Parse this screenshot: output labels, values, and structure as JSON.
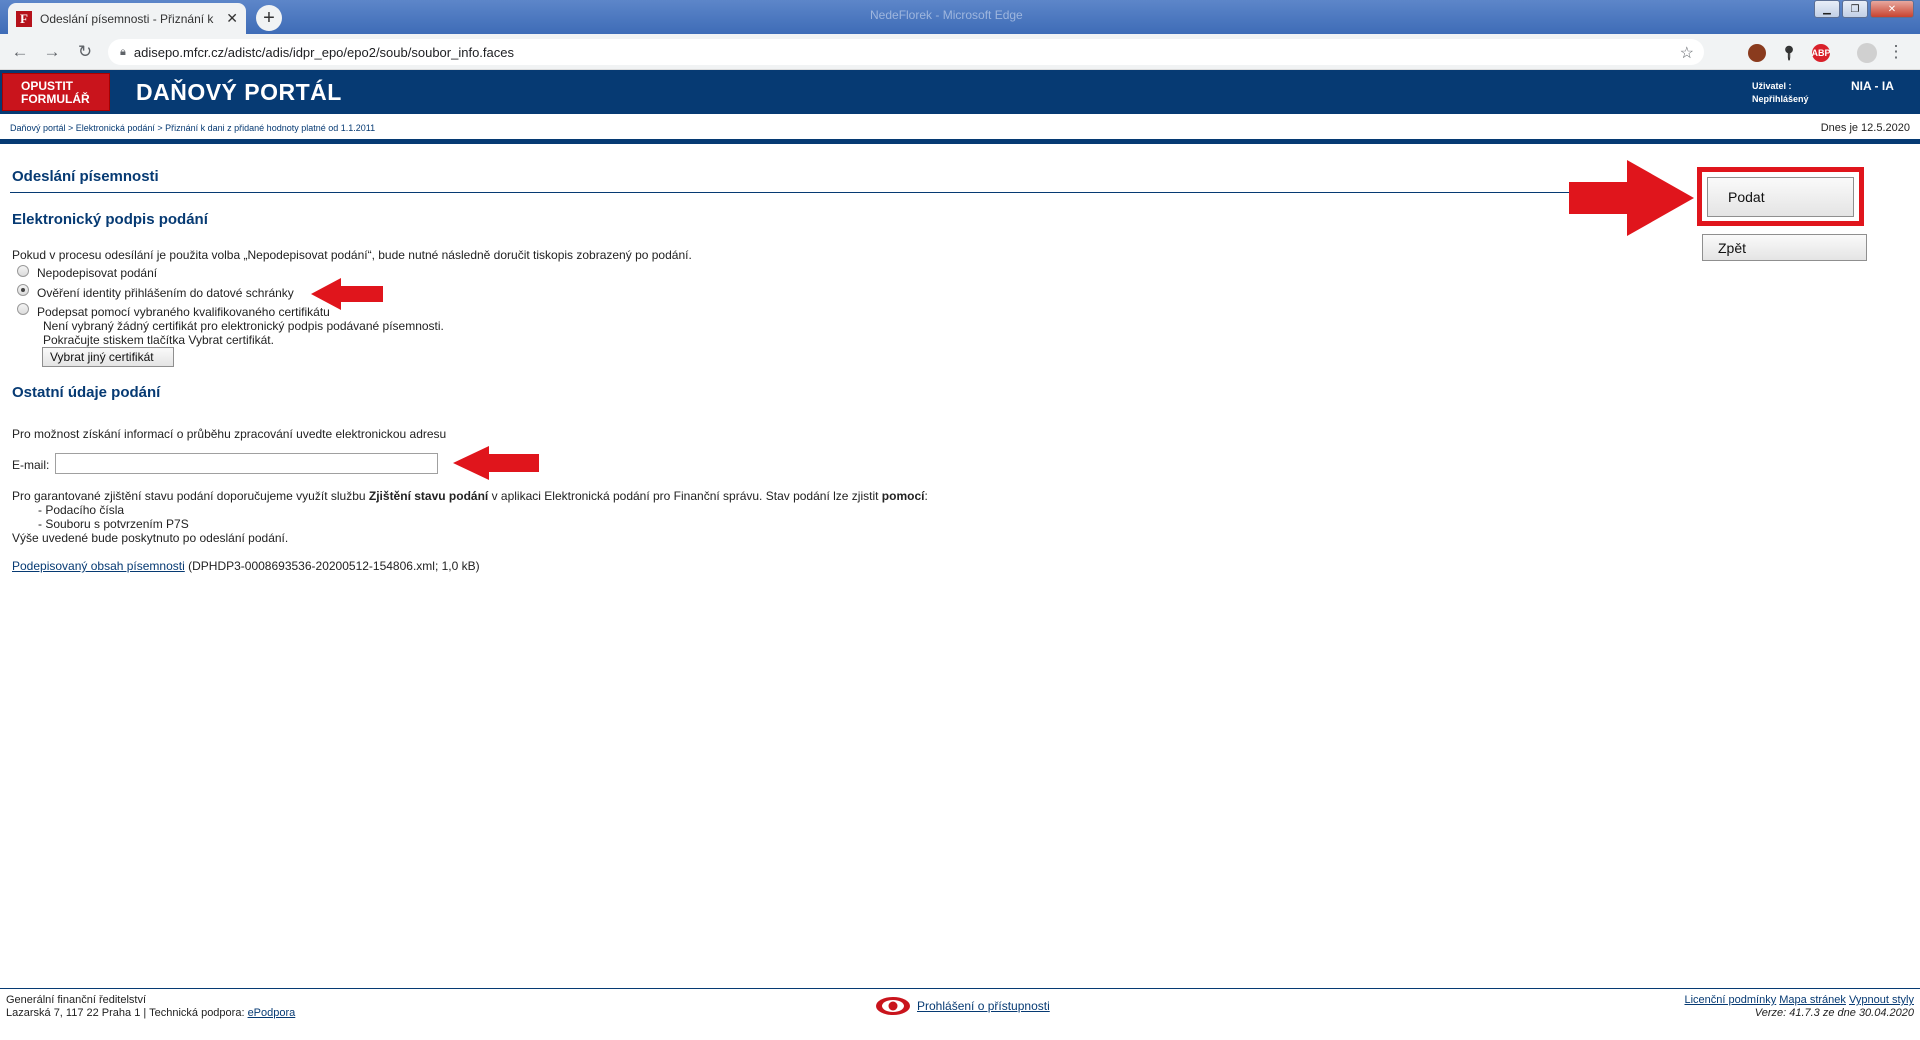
{
  "browser": {
    "tab_title": "Odeslání písemnosti - Přiznání k",
    "tab_favicon": "F",
    "window_title": "NedeFlorek - Microsoft Edge",
    "url": "adisepo.mfcr.cz/adistc/adis/idpr_epo/epo2/soub/soubor_info.faces",
    "extensions": [
      "ABP"
    ]
  },
  "header": {
    "exit_line1": "OPUSTIT",
    "exit_line2": "FORMULÁŘ",
    "title": "DAŇOVÝ PORTÁL",
    "user_label_line1": "Uživatel :",
    "user_label_line2": "Nepřihlášený",
    "user_value": "NIA - IA"
  },
  "breadcrumb": {
    "items": [
      "Daňový portál",
      "Elektronická podání",
      "Přiznání k dani z přidané hodnoty platné od 1.1.2011"
    ],
    "separator": " > ",
    "today": "Dnes je 12.5.2020"
  },
  "main": {
    "heading": "Odeslání písemnosti",
    "signature_heading": "Elektronický podpis podání",
    "signature_info": "Pokud v procesu odesílání je použita volba „Nepodepisovat podání“, bude nutné následně doručit tiskopis zobrazený po podání.",
    "options": [
      {
        "label": "Nepodepisovat podání",
        "checked": false
      },
      {
        "label": "Ověření identity přihlášením do datové schránky",
        "checked": true
      },
      {
        "label": "Podepsat pomocí vybraného kvalifikovaného certifikátu",
        "checked": false
      }
    ],
    "cert_note_1": "Není vybraný žádný certifikát pro elektronický podpis podávané písemnosti.",
    "cert_note_2": "Pokračujte stiskem tlačítka Vybrat certifikát.",
    "choose_cert_button": "Vybrat jiný certifikát",
    "other_heading": "Ostatní údaje podání",
    "email_info": "Pro možnost získání informací o průběhu zpracování uvedte elektronickou adresu",
    "email_label": "E-mail:",
    "email_value": "",
    "status_text_a": "Pro garantované zjištění stavu podání doporučujeme využít službu ",
    "status_text_b": "Zjištění stavu podání",
    "status_text_c": " v aplikaci Elektronická podání pro Finanční správu. Stav podání lze zjistit ",
    "status_text_d": "pomocí",
    "status_text_e": ":",
    "status_item_1": "- Podacího čísla",
    "status_item_2": "- Souboru s potvrzením P7S",
    "status_footer": "Výše uvedené bude poskytnuto po odeslání podání.",
    "signed_link": "Podepisovaný obsah písemnosti",
    "signed_file": " (DPHDP3-0008693536-20200512-154806.xml; 1,0 kB)"
  },
  "actions": {
    "submit": "Podat",
    "back": "Zpět"
  },
  "annotations": {
    "arrow_color": "#e0151c"
  },
  "footer": {
    "org": "Generální finanční ředitelství",
    "address": "Lazarská 7, 117 22 Praha 1 | Technická podpora: ",
    "support_link": "ePodpora",
    "accessibility_link": "Prohlášení o přístupnosti",
    "link_license": "Licenční podmínky",
    "link_sitemap": "Mapa stránek",
    "link_styles": "Vypnout styly",
    "version": "Verze: 41.7.3 ze dne 30.04.2020"
  }
}
